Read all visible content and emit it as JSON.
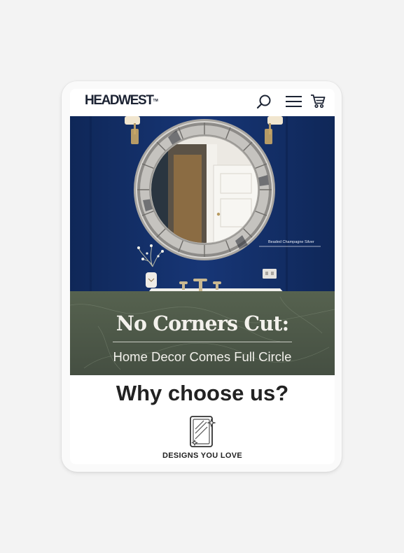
{
  "header": {
    "logo_text": "HEADWEST",
    "logo_tm": "TM",
    "icons": [
      "search-icon",
      "menu-icon",
      "cart-icon"
    ]
  },
  "hero": {
    "product_label": "Beaded Champagne Silver",
    "title": "No Corners Cut:",
    "subtitle": "Home Decor Comes Full Circle",
    "colors": {
      "wall": "#14306a",
      "counter": "#4e5a4a",
      "text": "#f3f1ec"
    }
  },
  "why": {
    "heading": "Why choose us?",
    "features": [
      {
        "icon": "mirror-sparkle-icon",
        "label": "DESIGNS YOU LOVE"
      }
    ]
  }
}
